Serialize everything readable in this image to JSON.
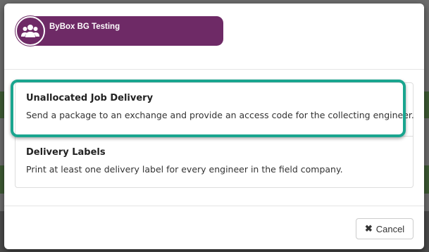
{
  "header": {
    "brand_title": "ByBox BG Testing",
    "brand_icon": "users-icon",
    "brand_color": "#6e2a66"
  },
  "options": [
    {
      "title": "Unallocated Job Delivery",
      "description": "Send a package to an exchange and provide an access code for the collecting engineer.",
      "highlighted": true
    },
    {
      "title": "Delivery Labels",
      "description": "Print at least one delivery label for every engineer in the field company.",
      "highlighted": false
    }
  ],
  "highlight_color": "#1aa58f",
  "footer": {
    "cancel_label": "Cancel",
    "cancel_icon": "close-icon"
  }
}
